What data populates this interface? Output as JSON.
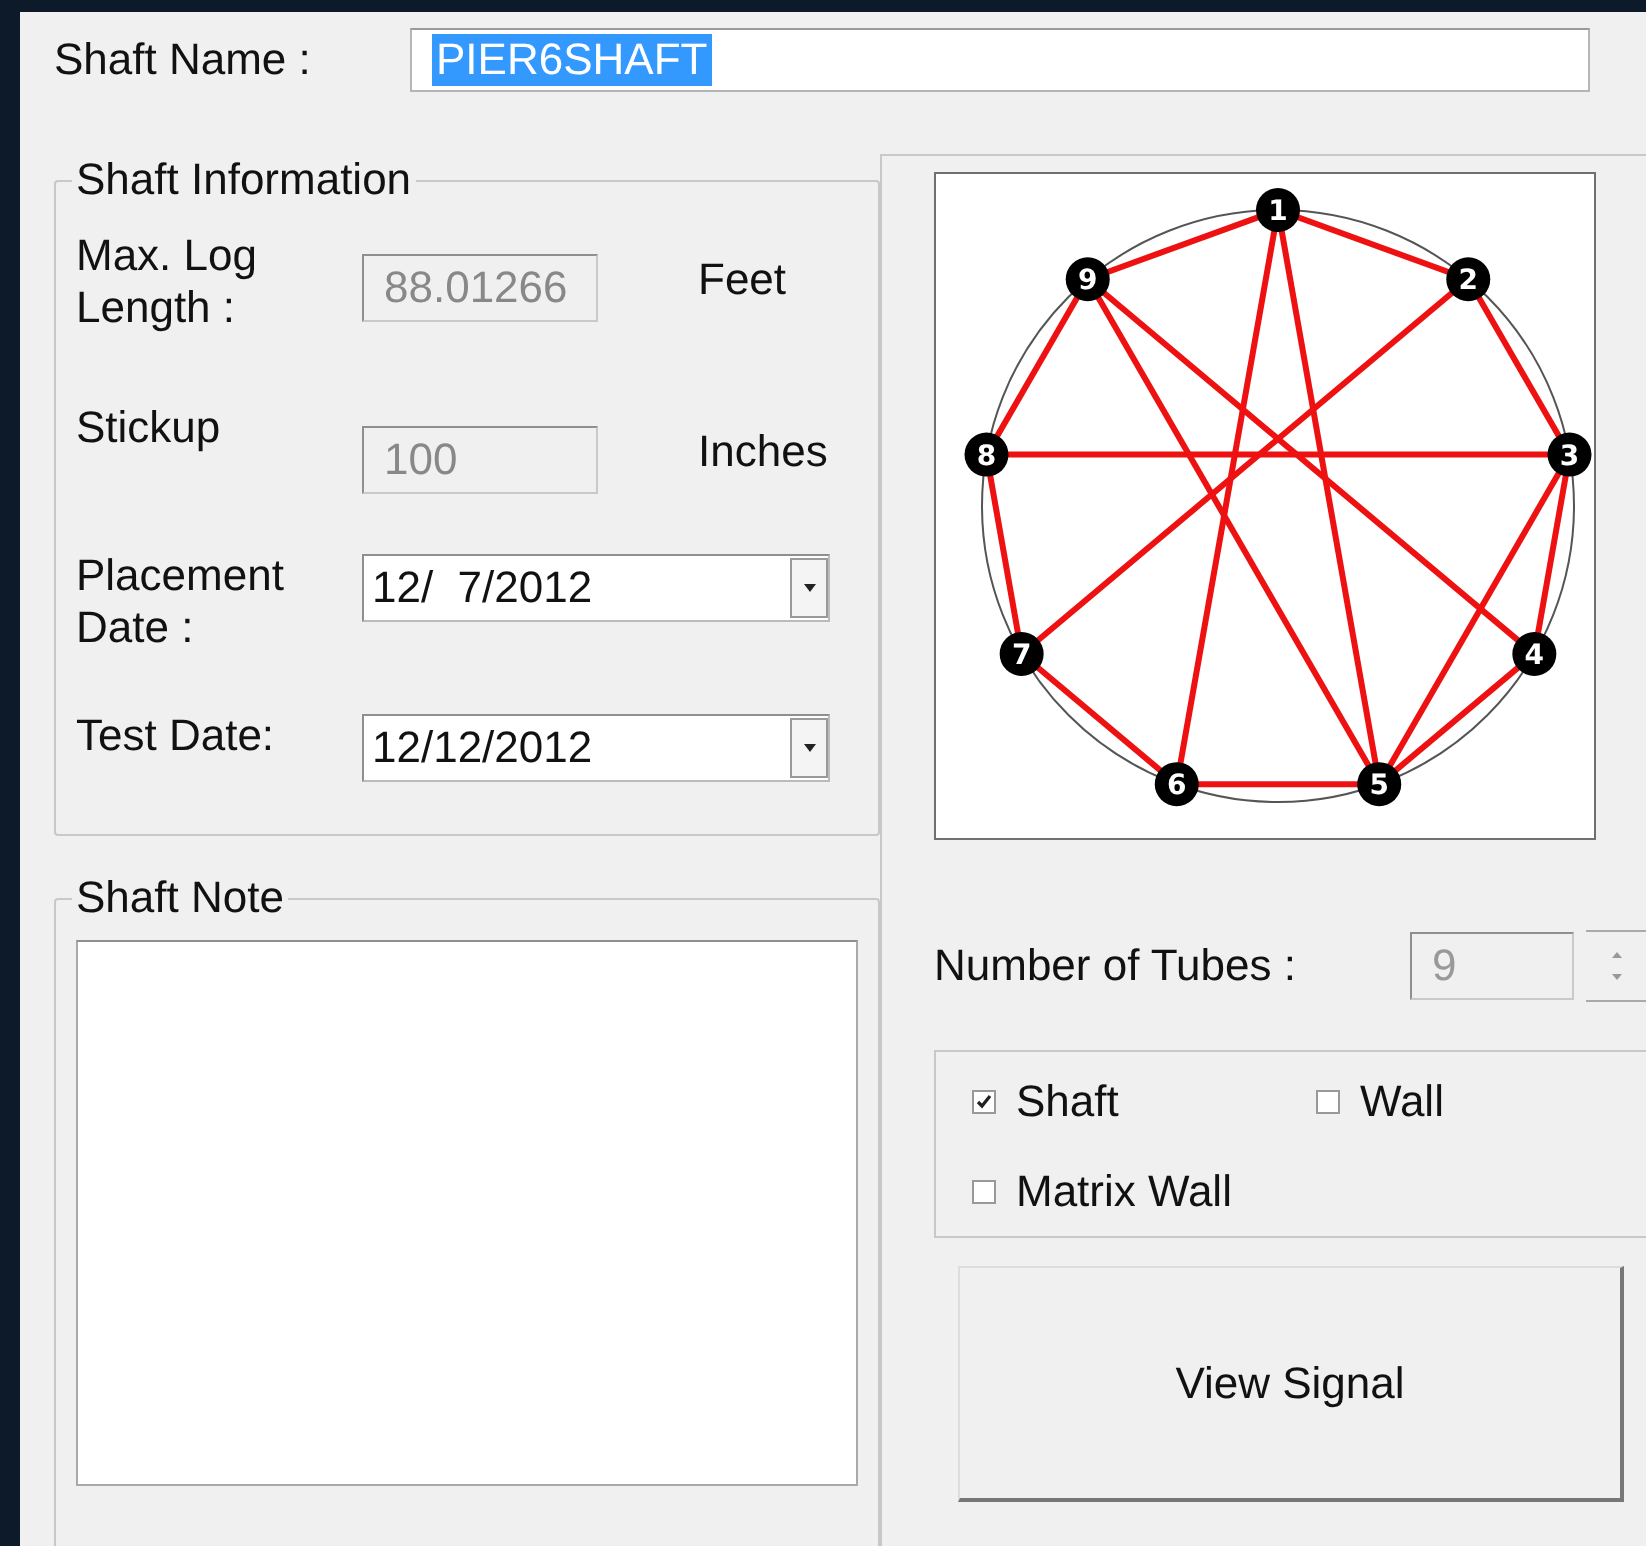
{
  "shaft_name": {
    "label": "Shaft Name :",
    "value": "PIER6SHAFT",
    "selected": true
  },
  "shaft_information": {
    "title": "Shaft Information",
    "fields": [
      {
        "kind": "readonly",
        "label": "Max. Log Length :",
        "value": "88.01266",
        "unit": "Feet"
      },
      {
        "kind": "readonly",
        "label": "Stickup",
        "value": "100",
        "unit": "Inches"
      },
      {
        "kind": "date",
        "label": "Placement Date :",
        "value": "12/  7/2012"
      },
      {
        "kind": "date",
        "label": "Test Date:",
        "value": "12/12/2012"
      }
    ]
  },
  "tube_diagram": {
    "tubes": [
      "1",
      "2",
      "3",
      "4",
      "5",
      "6",
      "7",
      "8",
      "9"
    ]
  },
  "shaft_note": {
    "title": "Shaft Note"
  },
  "number_of_tubes": {
    "label": "Number of Tubes :",
    "value": "9",
    "disabled": true
  },
  "options": [
    {
      "label": "Shaft",
      "checked": true
    },
    {
      "label": "Wall",
      "checked": false
    },
    {
      "label": "Matrix Wall",
      "checked": false
    }
  ],
  "buttons": [
    {
      "label": "View Signal"
    }
  ]
}
